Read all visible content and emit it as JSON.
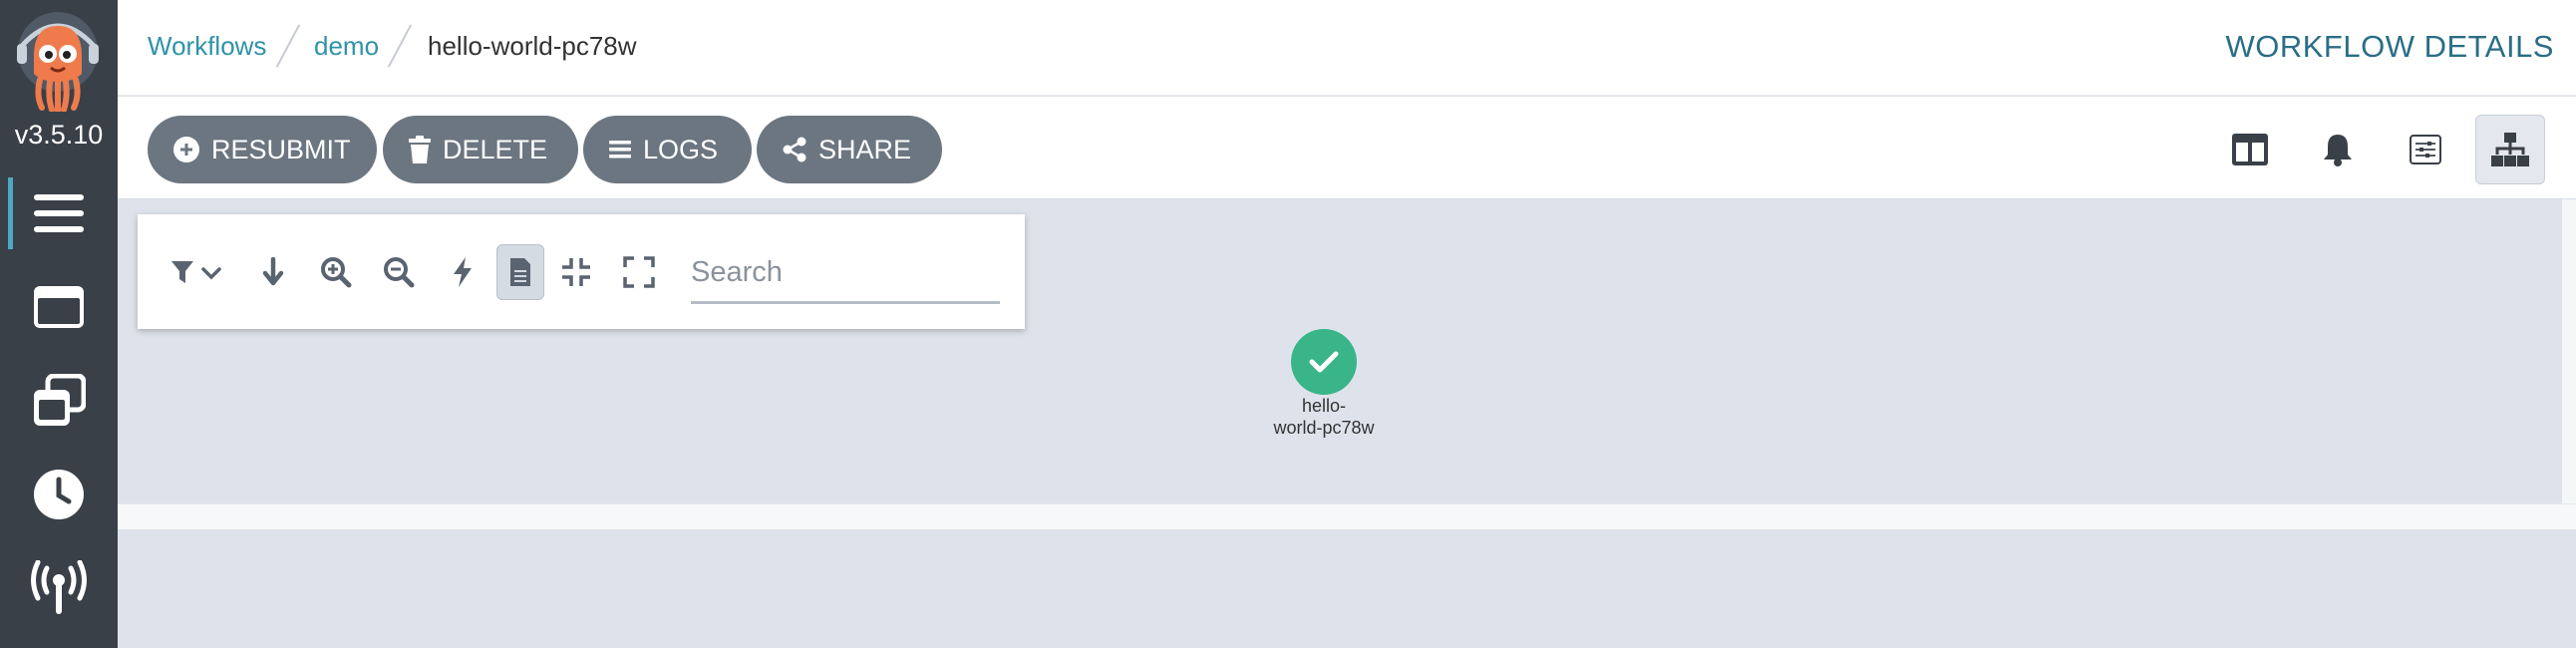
{
  "sidebar": {
    "version": "v3.5.10",
    "items": [
      {
        "icon": "bars-icon",
        "active": true
      },
      {
        "icon": "window-icon",
        "active": false
      },
      {
        "icon": "copy-icon",
        "active": false
      },
      {
        "icon": "clock-icon",
        "active": false
      },
      {
        "icon": "broadcast-tower-icon",
        "active": false
      }
    ]
  },
  "breadcrumb": {
    "items": [
      "Workflows",
      "demo"
    ],
    "current": "hello-world-pc78w"
  },
  "header": {
    "title": "WORKFLOW DETAILS"
  },
  "actions": {
    "resubmit": "RESUBMIT",
    "delete": "DELETE",
    "logs": "LOGS",
    "share": "SHARE"
  },
  "search": {
    "placeholder": "Search"
  },
  "graph": {
    "node_label_line1": "hello-",
    "node_label_line2": "world-pc78w",
    "node_status": "succeeded"
  },
  "colors": {
    "sidebar": "#3a4048",
    "accent": "#2f93a8",
    "button": "#6c7681",
    "success": "#39b589",
    "graph_bg": "#dee3eb"
  }
}
